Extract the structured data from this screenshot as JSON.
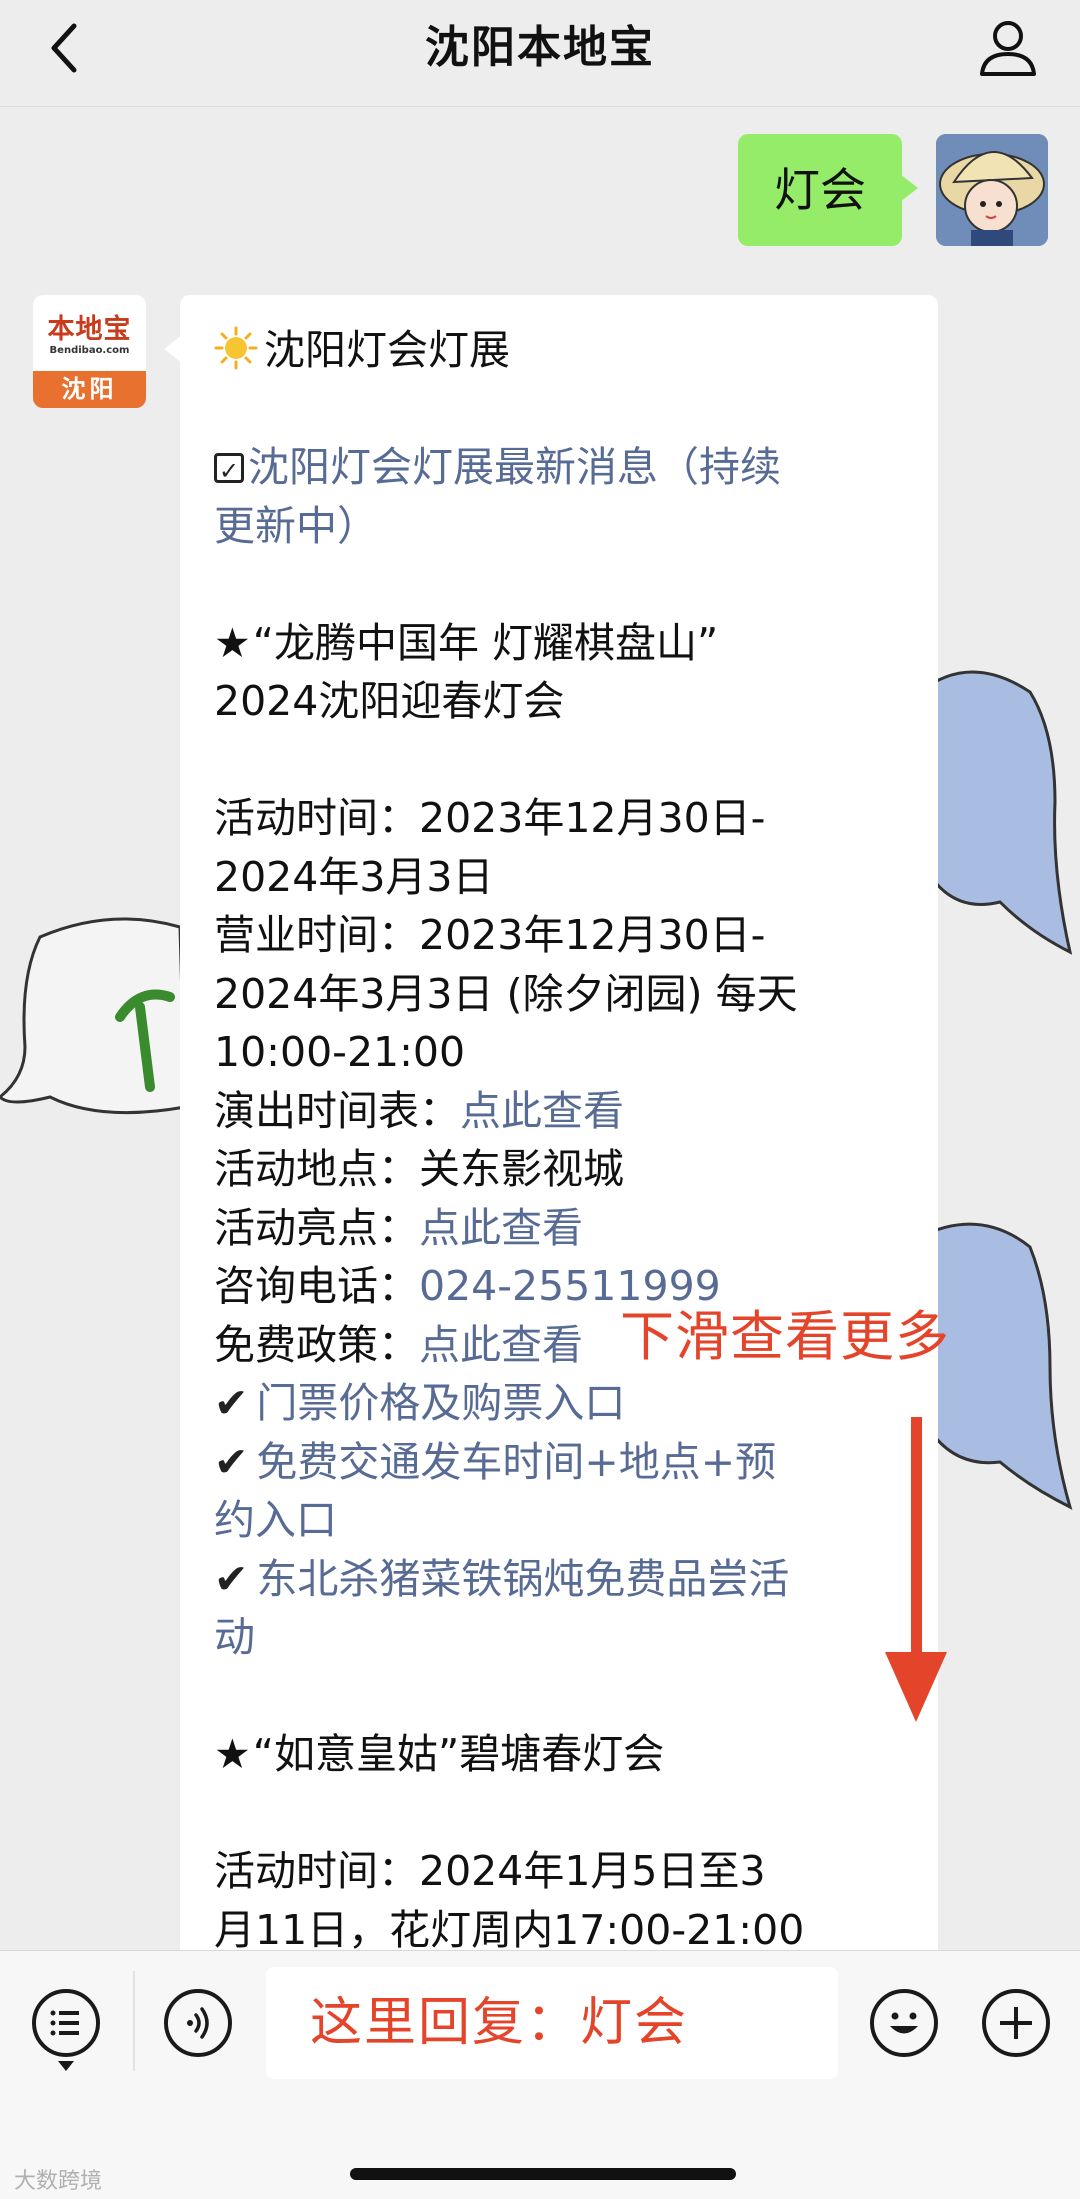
{
  "header": {
    "title": "沈阳本地宝"
  },
  "outgoing_message": {
    "text": "灯会"
  },
  "bot": {
    "avatar_logo": "本地宝",
    "avatar_site": "Bendibao.com",
    "avatar_city": "沈阳"
  },
  "message": {
    "heading": "沈阳灯会灯展",
    "news_link_line1": "沈阳灯会灯展最新消息（持续",
    "news_link_line2": "更新中）",
    "event1_title_line1": "“龙腾中国年 灯耀棋盘山”",
    "event1_title_line2": "2024沈阳迎春灯会",
    "activity_time_label": "活动时间：",
    "activity_time_value_line1": "2023年12月30日-",
    "activity_time_value_line2": "2024年3月3日",
    "business_time_label": "营业时间：",
    "business_time_value_line1": "2023年12月30日-",
    "business_time_value_line2": "2024年3月3日 (除夕闭园) 每天",
    "business_time_value_line3": "10:00-21:00",
    "show_schedule_label": "演出时间表：",
    "show_schedule_link": "点此查看",
    "location_label": "活动地点：",
    "location_value": "关东影视城",
    "highlights_label": "活动亮点：",
    "highlights_link": "点此查看",
    "phone_label": "咨询电话：",
    "phone_value": "024-25511999",
    "free_policy_label": "免费政策：",
    "free_policy_link": "点此查看",
    "ticket_link": "门票价格及购票入口",
    "shuttle_link_line1": "免费交通发车时间+地点+预",
    "shuttle_link_line2": "约入口",
    "food_link_line1": "东北杀猪菜铁锅炖免费品尝活",
    "food_link_line2": "动",
    "event2_title": "“如意皇姑”碧塘春灯会",
    "event2_time_label": "活动时间：",
    "event2_time_value_line1": "2024年1月5日至3",
    "event2_time_value_line2": "月11日，花灯周内17:00-21:00"
  },
  "overlay": {
    "scroll_hint": "下滑查看更多"
  },
  "input_bar": {
    "reply_hint": "这里回复：灯会"
  },
  "watermark": {
    "text": "大数跨境"
  },
  "colors": {
    "link": "#576b95",
    "outgoing_bubble": "#95ec69",
    "annotation_red": "#e4442a",
    "background": "#ededed"
  }
}
